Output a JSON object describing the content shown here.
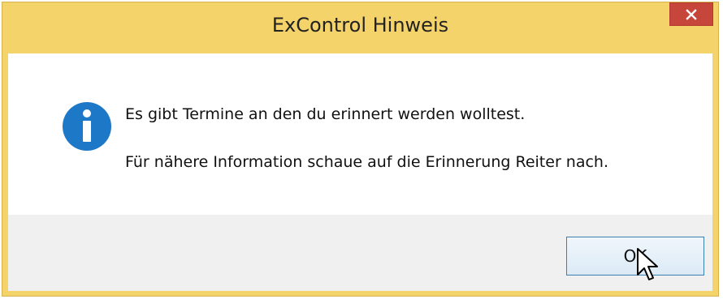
{
  "dialog": {
    "title": "ExControl Hinweis",
    "message_line1": "Es gibt Termine an den du erinnert werden wolltest.",
    "message_line2": "Für nähere Information schaue auf die Erinnerung Reiter nach.",
    "ok_label": "OK",
    "icon": "info-icon",
    "close_icon": "close-icon"
  },
  "colors": {
    "frame": "#f4d36b",
    "close_button": "#c7463c",
    "info_icon": "#1e78c8",
    "ok_border": "#3c7fb1",
    "footer": "#f0f0f0"
  }
}
